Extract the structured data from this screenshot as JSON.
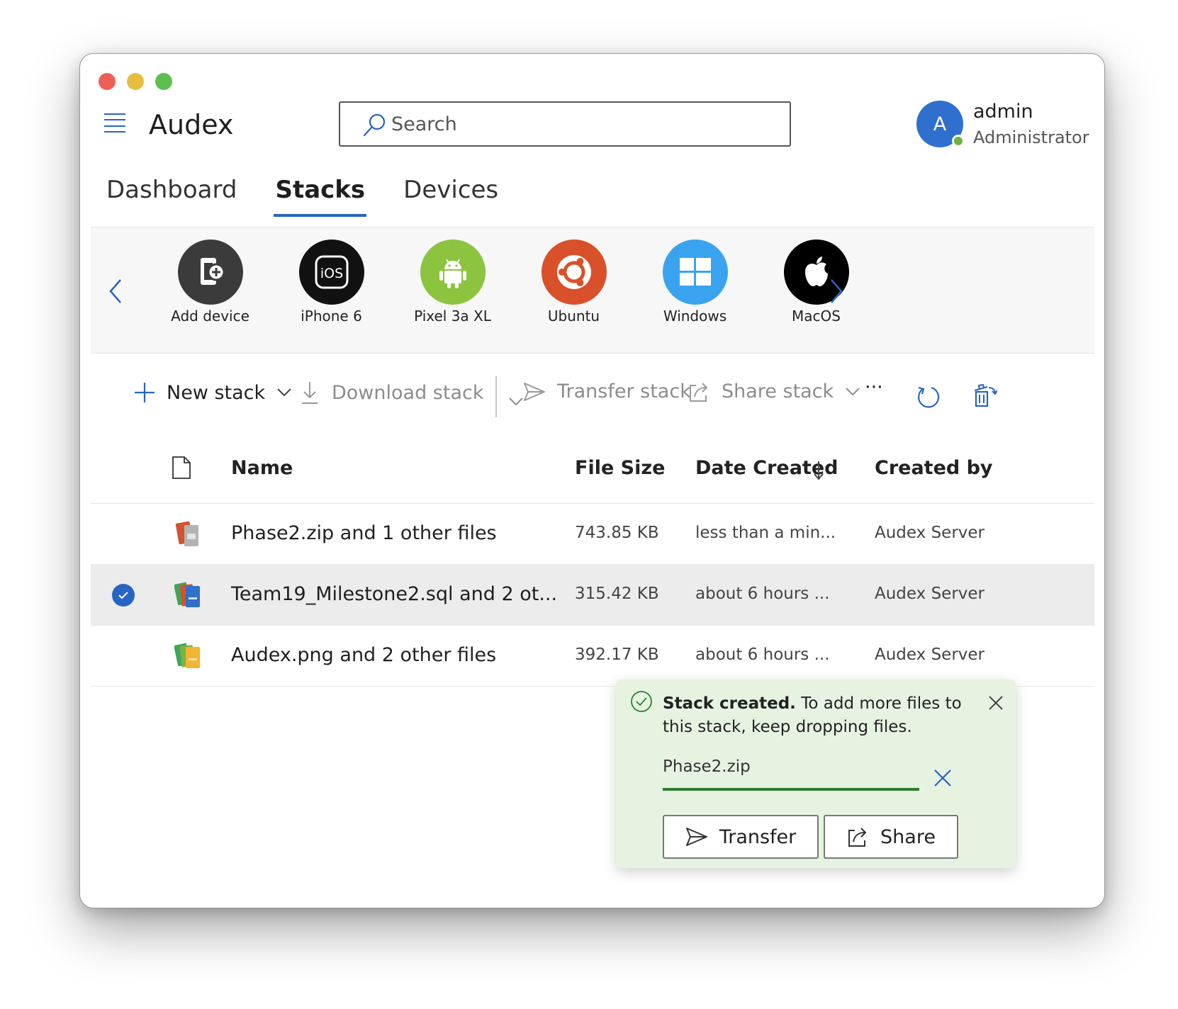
{
  "app": {
    "title": "Audex"
  },
  "search": {
    "placeholder": "Search"
  },
  "user": {
    "initial": "A",
    "name": "admin",
    "role": "Administrator",
    "status": "online"
  },
  "tabs": [
    {
      "label": "Dashboard",
      "active": false
    },
    {
      "label": "Stacks",
      "active": true
    },
    {
      "label": "Devices",
      "active": false
    }
  ],
  "devices": [
    {
      "label": "Add device",
      "icon": "add-device-icon",
      "color": "#3b3b3b"
    },
    {
      "label": "iPhone 6",
      "icon": "ios-icon",
      "color": "#111111"
    },
    {
      "label": "Pixel 3a XL",
      "icon": "android-icon",
      "color": "#8cc43f"
    },
    {
      "label": "Ubuntu",
      "icon": "ubuntu-icon",
      "color": "#d8512a"
    },
    {
      "label": "Windows",
      "icon": "windows-icon",
      "color": "#3aa3ef"
    },
    {
      "label": "MacOS",
      "icon": "apple-icon",
      "color": "#000000"
    }
  ],
  "toolbar": {
    "new_stack": "New stack",
    "download_stack": "Download stack",
    "transfer_stack": "Transfer stack",
    "share_stack": "Share stack",
    "more": "···"
  },
  "table": {
    "columns": {
      "name": "Name",
      "size": "File Size",
      "date": "Date Created",
      "created_by": "Created by"
    },
    "sort": {
      "column": "date",
      "direction": "descending"
    },
    "rows": [
      {
        "name_main": "Phase2.zip",
        "name_rest": " and 1 other files",
        "size": "743.85 KB",
        "date": "less than a min...",
        "created_by": "Audex Server",
        "selected": false,
        "icon": "stack-red-icon"
      },
      {
        "name_main": "Team19_Milestone2.sql",
        "name_rest": " and 2 ot...",
        "size": "315.42 KB",
        "date": "about 6 hours ...",
        "created_by": "Audex Server",
        "selected": true,
        "icon": "stack-blue-icon"
      },
      {
        "name_main": "Audex.png",
        "name_rest": " and 2 other files",
        "size": "392.17 KB",
        "date": "about 6 hours ...",
        "created_by": "Audex Server",
        "selected": false,
        "icon": "stack-yellow-icon"
      }
    ]
  },
  "toast": {
    "title": "Stack created.",
    "message": " To add more files to this stack, keep dropping files.",
    "file": "Phase2.zip",
    "progress": 1.0,
    "transfer_label": "Transfer",
    "share_label": "Share"
  },
  "colors": {
    "accent": "#2764c4",
    "toast_bg": "#e6f3e1",
    "progress": "#2e7d32",
    "selected_row": "#ececec"
  }
}
